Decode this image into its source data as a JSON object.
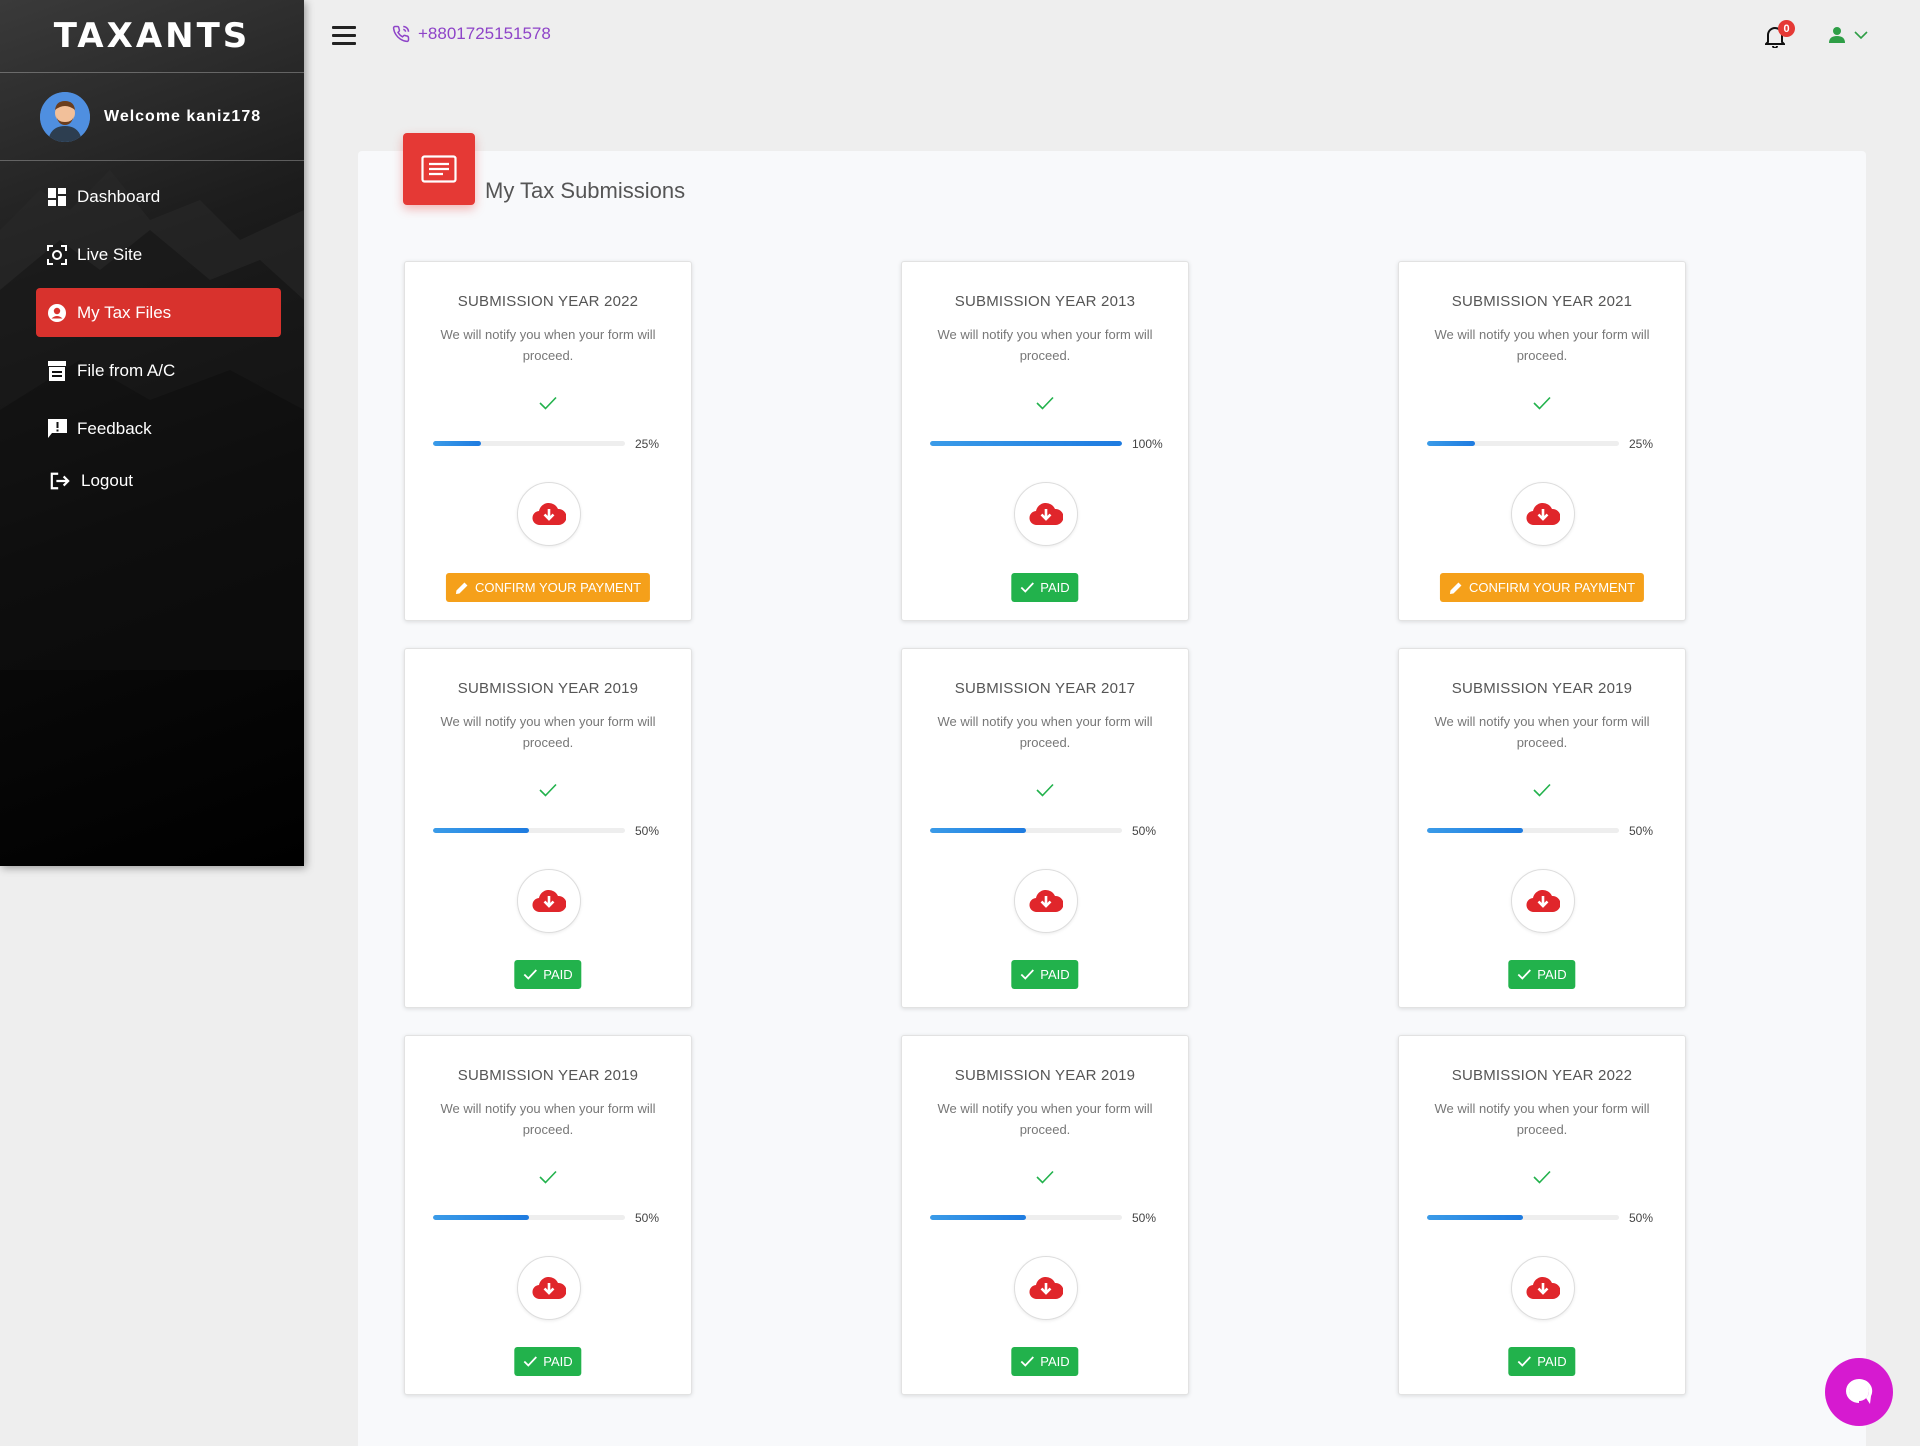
{
  "brand": {
    "logo_text": "TAXANTS"
  },
  "user": {
    "welcome": "Welcome kaniz178"
  },
  "sidebar": {
    "items": [
      {
        "label": "Dashboard",
        "icon": "dashboard-icon",
        "active": false
      },
      {
        "label": "Live Site",
        "icon": "live-site-icon",
        "active": false
      },
      {
        "label": "My Tax Files",
        "icon": "account-circle-icon",
        "active": true
      },
      {
        "label": "File from A/C",
        "icon": "archive-icon",
        "active": false
      },
      {
        "label": "Feedback",
        "icon": "feedback-icon",
        "active": false
      },
      {
        "label": "Logout",
        "icon": "logout-icon",
        "active": false
      }
    ]
  },
  "topbar": {
    "phone": "+8801725151578",
    "notification_count": "0"
  },
  "main": {
    "title": "My Tax Submissions",
    "submissions": [
      {
        "year": "SUBMISSION YEAR 2022",
        "note": "We will notify you when your form will proceed.",
        "progress": 25,
        "progress_label": "25%",
        "status": "CONFIRM YOUR PAYMENT",
        "status_type": "pay"
      },
      {
        "year": "SUBMISSION YEAR 2013",
        "note": "We will notify you when your form will proceed.",
        "progress": 100,
        "progress_label": "100%",
        "status": "PAID",
        "status_type": "paid"
      },
      {
        "year": "SUBMISSION YEAR 2021",
        "note": "We will notify you when your form will proceed.",
        "progress": 25,
        "progress_label": "25%",
        "status": "CONFIRM YOUR PAYMENT",
        "status_type": "pay"
      },
      {
        "year": "SUBMISSION YEAR 2019",
        "note": "We will notify you when your form will proceed.",
        "progress": 50,
        "progress_label": "50%",
        "status": "PAID",
        "status_type": "paid"
      },
      {
        "year": "SUBMISSION YEAR 2017",
        "note": "We will notify you when your form will proceed.",
        "progress": 50,
        "progress_label": "50%",
        "status": "PAID",
        "status_type": "paid"
      },
      {
        "year": "SUBMISSION YEAR 2019",
        "note": "We will notify you when your form will proceed.",
        "progress": 50,
        "progress_label": "50%",
        "status": "PAID",
        "status_type": "paid"
      },
      {
        "year": "SUBMISSION YEAR 2019",
        "note": "We will notify you when your form will proceed.",
        "progress": 50,
        "progress_label": "50%",
        "status": "PAID",
        "status_type": "paid"
      },
      {
        "year": "SUBMISSION YEAR 2019",
        "note": "We will notify you when your form will proceed.",
        "progress": 50,
        "progress_label": "50%",
        "status": "PAID",
        "status_type": "paid"
      },
      {
        "year": "SUBMISSION YEAR 2022",
        "note": "We will notify you when your form will proceed.",
        "progress": 50,
        "progress_label": "50%",
        "status": "PAID",
        "status_type": "paid"
      }
    ]
  },
  "colors": {
    "accent_red": "#e53935",
    "paid_green": "#22b24c",
    "pay_orange": "#f5a01a",
    "progress_blue": "#1e7be0",
    "phone_purple": "#8e44c8",
    "chat_magenta": "#d61ad0"
  }
}
